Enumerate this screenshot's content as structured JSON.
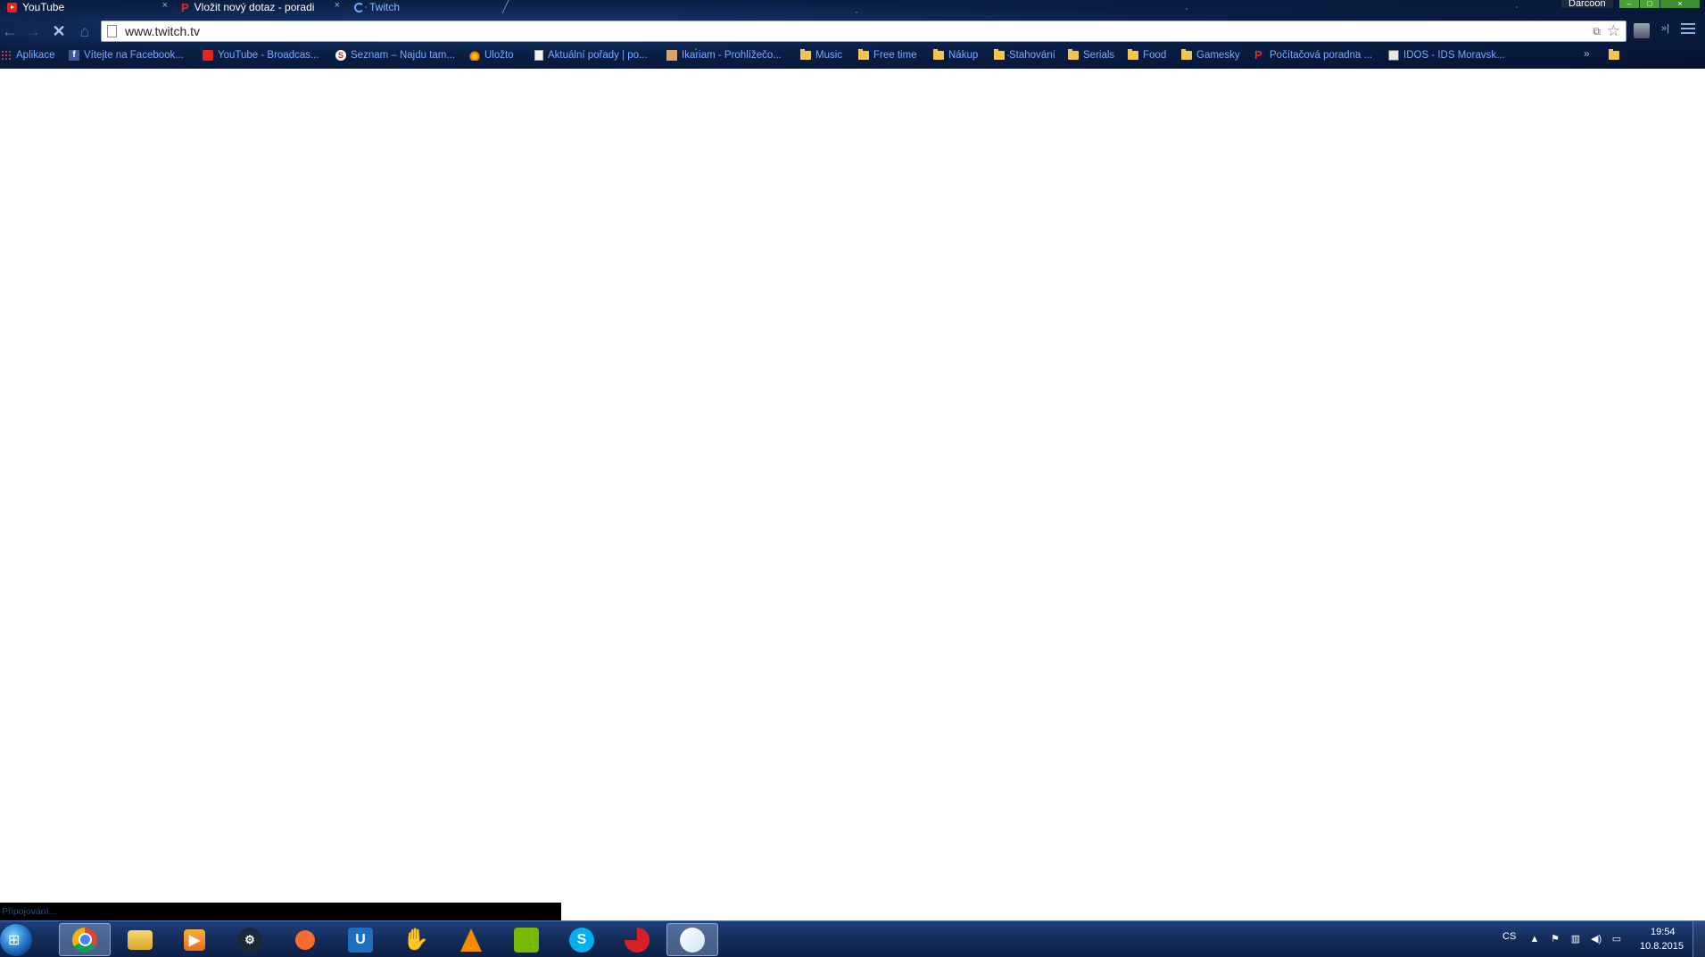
{
  "browser": {
    "tabs": [
      {
        "title": "YouTube",
        "icon": "youtube-icon",
        "close": "×"
      },
      {
        "title": "Vložit nový dotaz - poradi",
        "icon": "poradna-icon",
        "close": "×"
      },
      {
        "title": "Twitch",
        "icon": "loading-spinner-icon"
      }
    ],
    "profile_name": "Darcoon",
    "window_controls": {
      "minimize": "–",
      "maximize": "□",
      "close": "×"
    },
    "nav": {
      "back": "←",
      "forward": "→",
      "stop": "✕",
      "home": "⌂"
    },
    "url": "www.twitch.tv",
    "bookmarks": [
      {
        "label": "Aplikace",
        "icon": "apps-icon"
      },
      {
        "label": "Vítejte na Facebook...",
        "icon": "facebook-icon"
      },
      {
        "label": "YouTube - Broadcas...",
        "icon": "youtube-icon"
      },
      {
        "label": "Seznam – Najdu tam...",
        "icon": "seznam-icon"
      },
      {
        "label": "Uložto",
        "icon": "ulozto-icon"
      },
      {
        "label": "Aktuální pořady | po...",
        "icon": "page-icon"
      },
      {
        "label": "Ikariam - Prohlížečo...",
        "icon": "ikariam-icon"
      },
      {
        "label": "Music",
        "icon": "folder-icon"
      },
      {
        "label": "Free time",
        "icon": "folder-icon"
      },
      {
        "label": "Nákup",
        "icon": "folder-icon"
      },
      {
        "label": "Stahování",
        "icon": "folder-icon"
      },
      {
        "label": "Serials",
        "icon": "folder-icon"
      },
      {
        "label": "Food",
        "icon": "folder-icon"
      },
      {
        "label": "Gamesky",
        "icon": "folder-icon"
      },
      {
        "label": "Počítačová poradna ...",
        "icon": "poradna-icon"
      },
      {
        "label": "IDOS - IDS Moravsk...",
        "icon": "idos-icon"
      }
    ],
    "bookmarks_overflow": "»",
    "status_text": "Připojování..."
  },
  "taskbar": {
    "apps": [
      {
        "name": "chrome",
        "icon": "chrome-icon",
        "active": true
      },
      {
        "name": "explorer",
        "icon": "folder-icon"
      },
      {
        "name": "media-player",
        "icon": "media-player-icon"
      },
      {
        "name": "steam",
        "icon": "steam-icon",
        "glyph": "⚙"
      },
      {
        "name": "origin",
        "icon": "origin-icon"
      },
      {
        "name": "uplay",
        "icon": "uplay-icon",
        "glyph": "U"
      },
      {
        "name": "raptr",
        "icon": "raptr-icon",
        "glyph": "✋"
      },
      {
        "name": "vlc",
        "icon": "vlc-icon"
      },
      {
        "name": "nvidia",
        "icon": "nvidia-icon"
      },
      {
        "name": "skype",
        "icon": "skype-icon",
        "glyph": "S"
      },
      {
        "name": "ccleaner",
        "icon": "ccleaner-icon"
      },
      {
        "name": "paint",
        "icon": "paint-icon",
        "active": true
      }
    ],
    "language": "CS",
    "tray": {
      "arrow": "▲",
      "flag": "⚑",
      "network": "▥",
      "volume": "◀)",
      "action": "▭"
    },
    "time": "19:54",
    "date": "10.8.2015"
  },
  "colors": {
    "bookmark_text": "#78aaff",
    "taskbar": "#132c5a",
    "window_button": "#4aa13c",
    "page_background": "#ffffff"
  }
}
